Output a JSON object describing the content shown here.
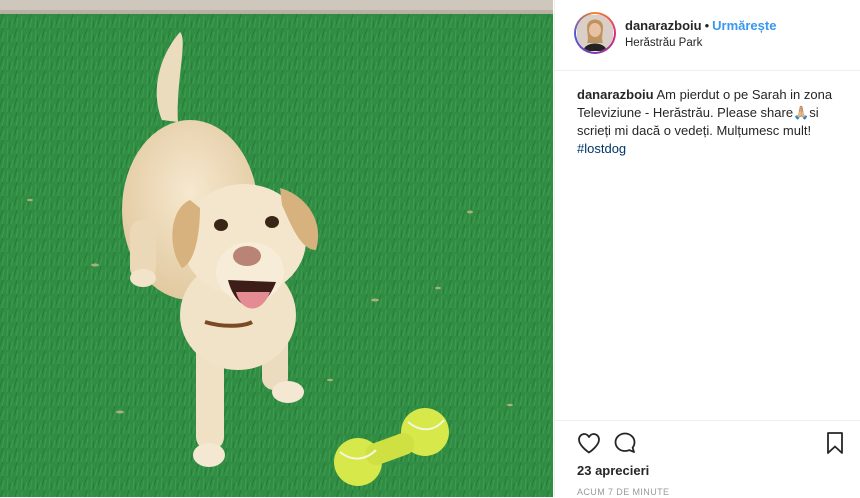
{
  "post": {
    "username": "danarazboiu",
    "separator": "•",
    "follow_label": "Urmărește",
    "location": "Herăstrău Park"
  },
  "caption": {
    "username": "danarazboiu",
    "text_part1": "Am pierdut o pe Sarah in zona Televiziune - Herăstrău. Please share",
    "emoji": "🙏🏼",
    "text_part2": "si scrieți mi dacă o vedeți. Mulțumesc mult!",
    "hashtag": "#lostdog"
  },
  "stats": {
    "likes": "23 aprecieri",
    "time": "ACUM 7 DE MINUTE"
  },
  "icons": {
    "like": "heart-icon",
    "comment": "comment-bubble-icon",
    "save": "bookmark-icon"
  },
  "colors": {
    "follow": "#3897f0",
    "hashtag": "#003569",
    "grass": "#2f8a41"
  }
}
